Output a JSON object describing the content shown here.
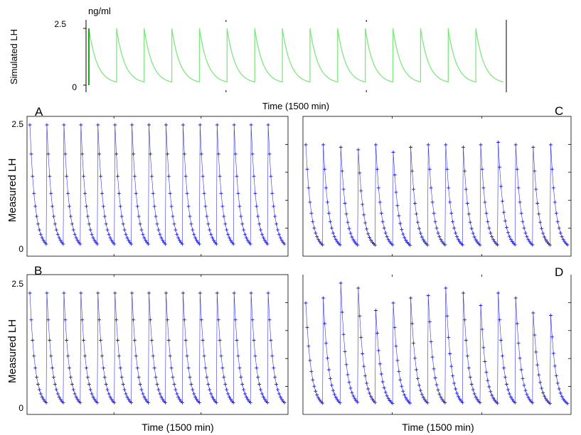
{
  "top": {
    "unit_label": "ng/ml",
    "ylabel": "Simulated LH",
    "xlabel": "Time (1500 min)",
    "yticks": [
      "2.5",
      "0"
    ]
  },
  "panels": {
    "A": {
      "letter": "A",
      "ylabel": "Measured LH",
      "yticks": [
        "2.5",
        "0"
      ]
    },
    "B": {
      "letter": "B",
      "ylabel": "Measured LH",
      "yticks": [
        "2.5",
        "0"
      ],
      "xlabel": "Time (1500 min)"
    },
    "C": {
      "letter": "C"
    },
    "D": {
      "letter": "D",
      "xlabel": "Time (1500 min)"
    }
  },
  "colors": {
    "simulated": "#7ee87e",
    "measured": "#1f1fd6",
    "axis": "#000000"
  },
  "chart_data": [
    {
      "id": "top",
      "type": "line",
      "ylabel": "Simulated LH",
      "xlabel": "Time (1500 min)",
      "ylim": [
        0,
        2.5
      ],
      "series": [
        {
          "peak_times": [
            0,
            100,
            200,
            300,
            400,
            500,
            600,
            700,
            800,
            900,
            1000,
            1100,
            1200,
            1300,
            1400
          ],
          "peak_values": [
            2.5,
            2.5,
            2.5,
            2.5,
            2.5,
            2.5,
            2.5,
            2.5,
            2.5,
            2.5,
            2.5,
            2.5,
            2.5,
            2.5,
            2.5
          ],
          "trough_value": 0.05
        }
      ]
    },
    {
      "id": "A",
      "type": "line",
      "ylabel": "Measured LH",
      "ylim": [
        0,
        2.5
      ],
      "series": [
        {
          "peak_times": [
            0,
            100,
            200,
            300,
            400,
            500,
            600,
            700,
            800,
            900,
            1000,
            1100,
            1200,
            1300,
            1400
          ],
          "peak_values": [
            2.5,
            2.5,
            2.5,
            2.5,
            2.5,
            2.5,
            2.5,
            2.5,
            2.5,
            2.5,
            2.5,
            2.5,
            2.5,
            2.5,
            2.5
          ]
        }
      ]
    },
    {
      "id": "B",
      "type": "line",
      "ylabel": "Measured LH",
      "xlabel": "Time (1500 min)",
      "ylim": [
        0,
        2.5
      ],
      "series": [
        {
          "peak_times": [
            0,
            100,
            200,
            300,
            400,
            500,
            600,
            700,
            800,
            900,
            1000,
            1100,
            1200,
            1300,
            1400
          ],
          "peak_values": [
            2.3,
            2.3,
            2.3,
            2.3,
            2.3,
            2.3,
            2.3,
            2.3,
            2.3,
            2.3,
            2.3,
            2.3,
            2.3,
            2.3,
            2.3
          ]
        }
      ]
    },
    {
      "id": "C",
      "type": "line",
      "ylim": [
        0,
        2.5
      ],
      "series": [
        {
          "peak_times": [
            0,
            100,
            200,
            300,
            400,
            500,
            600,
            700,
            800,
            900,
            1000,
            1100,
            1200,
            1300,
            1400
          ],
          "peak_values": [
            2.1,
            2.1,
            2.05,
            2.0,
            2.1,
            1.95,
            2.05,
            2.1,
            2.1,
            2.05,
            2.1,
            2.15,
            2.1,
            2.05,
            2.1
          ]
        }
      ]
    },
    {
      "id": "D",
      "type": "line",
      "xlabel": "Time (1500 min)",
      "ylim": [
        0,
        2.5
      ],
      "series": [
        {
          "peak_times": [
            0,
            100,
            200,
            300,
            400,
            500,
            600,
            700,
            800,
            900,
            1000,
            1100,
            1200,
            1300,
            1400
          ],
          "peak_values": [
            2.1,
            2.2,
            2.5,
            2.4,
            1.95,
            2.1,
            2.2,
            2.25,
            2.4,
            2.3,
            2.05,
            2.3,
            2.2,
            1.9,
            1.85
          ]
        }
      ]
    }
  ]
}
